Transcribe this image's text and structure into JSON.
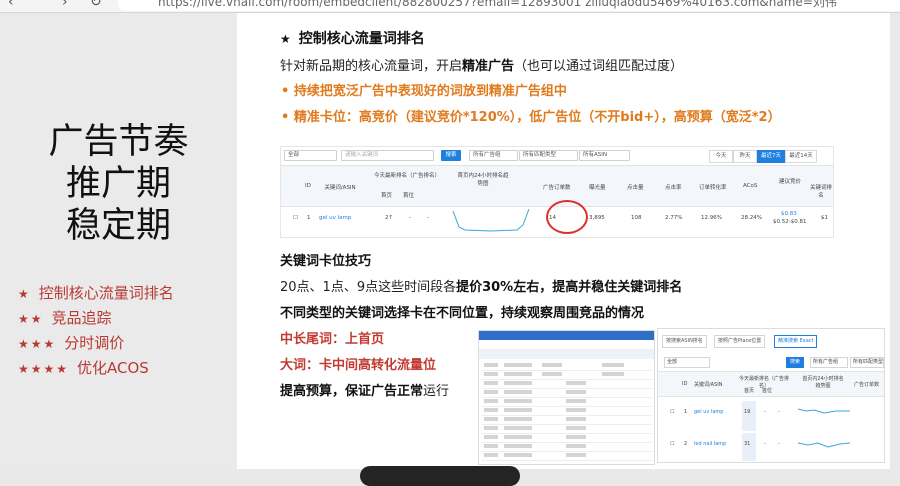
{
  "browser": {
    "nav_back": "‹",
    "nav_forward": "›",
    "nav_reload": "↻",
    "url": "https://live.vhall.com/room/embedclient/882800257?email=12893001 ziliuqiaodu5469%40163.com&name=刘伟"
  },
  "left": {
    "title_lines": [
      "广告节奏",
      "推广期",
      "稳定期"
    ],
    "items": [
      {
        "stars": "★",
        "label": "控制核心流量词排名"
      },
      {
        "stars": "★★",
        "label": "竞品追踪"
      },
      {
        "stars": "★★★",
        "label": "分时调价"
      },
      {
        "stars": "★★★★",
        "label": "优化ACOS"
      }
    ]
  },
  "content": {
    "heading_star": "★",
    "heading": "控制核心流量词排名",
    "intro_before": "针对新品期的核心流量词，开启",
    "intro_bold": "精准广告",
    "intro_after": "（也可以通过词组匹配过度）",
    "bullet1": "• 持续把宽泛广告中表现好的词放到精准广告组中",
    "bullet2": "• 精准卡位：高竞价（建议竞价*120%），低广告位（不开bid+），高预算（宽泛*2）",
    "section2_title": "关键词卡位技巧",
    "s2_line1_before": "20点、1点、9点这些时间段各",
    "s2_line1_bold": "提价30%左右，提高并稳住关键词排名",
    "s2_line2": "不同类型的关键词选择卡在不同位置，持续观察周围竞品的情况",
    "long_tail": "中长尾词：上首页",
    "big_word": "大词：卡中间高转化流量位",
    "budget_before": "提高预算，保证广告正常",
    "budget_after": "运行"
  },
  "ad_table": {
    "filter_all": "全部",
    "search_placeholder": "请输入关键词",
    "search_btn": "搜索",
    "all_groups": "所有广告组",
    "all_match": "所有匹配类型",
    "all_asin": "所有ASIN",
    "date_today": "今天",
    "date_yesterday": "昨天",
    "date_7d": "最近7天",
    "date_14d": "最近14天",
    "headers": [
      "ID",
      "关键词/ASIN",
      "今天最新排名（广告排名）",
      "首页",
      "首位",
      "首页内24小时排名趋势图",
      "广告订单数",
      "曝光量",
      "点击量",
      "点击率",
      "订单转化率",
      "ACoS",
      "建议竞价",
      "关键词排名"
    ],
    "row": {
      "id": "1",
      "keyword": "gel uv lamp",
      "rank": "2↑",
      "first_page": "-",
      "first_pos": "-",
      "orders": "14",
      "impressions": "3,895",
      "clicks": "108",
      "ctr": "2.77%",
      "cvr": "12.96%",
      "acos": "28.24%",
      "bid_main": "$0.83",
      "bid_range": "$0.52-$0.81",
      "kw_rank": "$1"
    }
  },
  "shot3": {
    "tab1": "按搜索ASIN排名",
    "tab2": "按照广告Place位置",
    "tab3": "精准搜索 Exact",
    "filter_all": "全部",
    "search_btn": "搜索",
    "all_groups": "所有广告组",
    "all_match": "所有匹配类型",
    "headers": [
      "ID",
      "关键词/ASIN",
      "今天最新排名（广告排名）",
      "首页",
      "首位",
      "首页内24小时排名趋势图",
      "广告订单数"
    ],
    "rows": [
      {
        "id": "1",
        "keyword": "gel uv lamp",
        "rank": "19",
        "first_page": "-",
        "first_pos": "-"
      },
      {
        "id": "2",
        "keyword": "led nail lamp",
        "rank": "31",
        "first_page": "-",
        "first_pos": "-"
      }
    ]
  },
  "colors": {
    "accent_red": "#c23a30",
    "accent_orange": "#e07a1d",
    "link_blue": "#1e7fe0"
  }
}
